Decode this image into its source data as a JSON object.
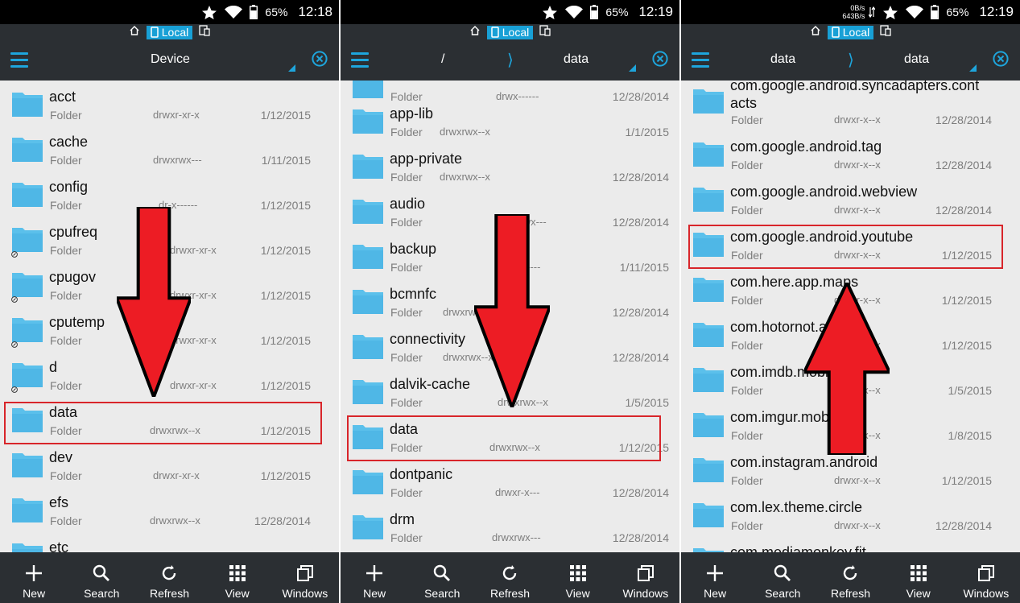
{
  "colors": {
    "accent": "#1ea5dc",
    "folder": "#5bc0eb",
    "toolbar": "#2b2f33",
    "list_background": "#ebebeb",
    "highlight": "#d8252a",
    "arrow": "#ed1c24"
  },
  "location_chip": "Local",
  "bottom_bar": [
    {
      "label": "New",
      "icon": "plus-icon"
    },
    {
      "label": "Search",
      "icon": "search-icon"
    },
    {
      "label": "Refresh",
      "icon": "refresh-icon"
    },
    {
      "label": "View",
      "icon": "grid-view-icon"
    },
    {
      "label": "Windows",
      "icon": "windows-icon"
    }
  ],
  "panels": [
    {
      "status": {
        "battery": "65%",
        "time": "12:18"
      },
      "toolbar": {
        "title": "Device"
      },
      "files": [
        {
          "name": "acct",
          "type": "Folder",
          "perm": "drwxr-xr-x",
          "date": "1/12/2015"
        },
        {
          "name": "cache",
          "type": "Folder",
          "perm": "drwxrwx---",
          "date": "1/11/2015"
        },
        {
          "name": "config",
          "type": "Folder",
          "perm": "dr-x------",
          "date": "1/12/2015"
        },
        {
          "name": "cpufreq",
          "type": "Folder",
          "perm": "drwxr-xr-x",
          "date": "1/12/2015",
          "link": true
        },
        {
          "name": "cpugov",
          "type": "Folder",
          "perm": "drwxr-xr-x",
          "date": "1/12/2015",
          "link": true
        },
        {
          "name": "cputemp",
          "type": "Folder",
          "perm": "drwxr-xr-x",
          "date": "1/12/2015",
          "link": true
        },
        {
          "name": "d",
          "type": "Folder",
          "perm": "drwxr-xr-x",
          "date": "1/12/2015",
          "link": true
        },
        {
          "name": "data",
          "type": "Folder",
          "perm": "drwxrwx--x",
          "date": "1/12/2015"
        },
        {
          "name": "dev",
          "type": "Folder",
          "perm": "drwxr-xr-x",
          "date": "1/12/2015"
        },
        {
          "name": "efs",
          "type": "Folder",
          "perm": "drwxrwx--x",
          "date": "12/28/2014"
        },
        {
          "name": "etc",
          "type": "",
          "perm": "",
          "date": ""
        }
      ]
    },
    {
      "status": {
        "battery": "65%",
        "time": "12:19"
      },
      "toolbar": {
        "path_left": "/",
        "path_right": "data"
      },
      "files": [
        {
          "name": "",
          "type": "Folder",
          "perm": "drwx------",
          "date": "12/28/2014"
        },
        {
          "name": "app-lib",
          "type": "Folder",
          "perm": "drwxrwx--x",
          "date": "1/1/2015"
        },
        {
          "name": "app-private",
          "type": "Folder",
          "perm": "drwxrwx--x",
          "date": "12/28/2014"
        },
        {
          "name": "audio",
          "type": "Folder",
          "perm": "drwxrwx---",
          "date": "12/28/2014"
        },
        {
          "name": "backup",
          "type": "Folder",
          "perm": "drwx------",
          "date": "1/11/2015"
        },
        {
          "name": "bcmnfc",
          "type": "Folder",
          "perm": "drwxrwx--x",
          "date": "12/28/2014"
        },
        {
          "name": "connectivity",
          "type": "Folder",
          "perm": "drwxrwx--x",
          "date": "12/28/2014"
        },
        {
          "name": "dalvik-cache",
          "type": "Folder",
          "perm": "drwxrwx--x",
          "date": "1/5/2015"
        },
        {
          "name": "data",
          "type": "Folder",
          "perm": "drwxrwx--x",
          "date": "1/12/2015"
        },
        {
          "name": "dontpanic",
          "type": "Folder",
          "perm": "drwxr-x---",
          "date": "12/28/2014"
        },
        {
          "name": "drm",
          "type": "Folder",
          "perm": "drwxrwx---",
          "date": "12/28/2014"
        }
      ]
    },
    {
      "status": {
        "net_down": "0B/s",
        "net_up": "643B/s",
        "battery": "65%",
        "time": "12:19"
      },
      "toolbar": {
        "path_left": "data",
        "path_right": "data"
      },
      "files": [
        {
          "name": "com.google.android.syncadapters.cont",
          "name2": "acts",
          "type": "Folder",
          "perm": "drwxr-x--x",
          "date": "12/28/2014"
        },
        {
          "name": "com.google.android.tag",
          "type": "Folder",
          "perm": "drwxr-x--x",
          "date": "12/28/2014"
        },
        {
          "name": "com.google.android.webview",
          "type": "Folder",
          "perm": "drwxr-x--x",
          "date": "12/28/2014"
        },
        {
          "name": "com.google.android.youtube",
          "type": "Folder",
          "perm": "drwxr-x--x",
          "date": "1/12/2015"
        },
        {
          "name": "com.here.app.maps",
          "type": "Folder",
          "perm": "drwxr-x--x",
          "date": "1/12/2015"
        },
        {
          "name": "com.hotornot.app",
          "type": "Folder",
          "perm": "drwxr-x--x",
          "date": "1/12/2015"
        },
        {
          "name": "com.imdb.mobile",
          "type": "Folder",
          "perm": "drwxr-x--x",
          "date": "1/5/2015"
        },
        {
          "name": "com.imgur.mobile",
          "type": "Folder",
          "perm": "drwxr-x--x",
          "date": "1/8/2015"
        },
        {
          "name": "com.instagram.android",
          "type": "Folder",
          "perm": "drwxr-x--x",
          "date": "1/12/2015"
        },
        {
          "name": "com.lex.theme.circle",
          "type": "Folder",
          "perm": "drwxr-x--x",
          "date": "12/28/2014"
        },
        {
          "name": "com.mediamonkey.fit",
          "type": "",
          "perm": "",
          "date": ""
        }
      ]
    }
  ]
}
